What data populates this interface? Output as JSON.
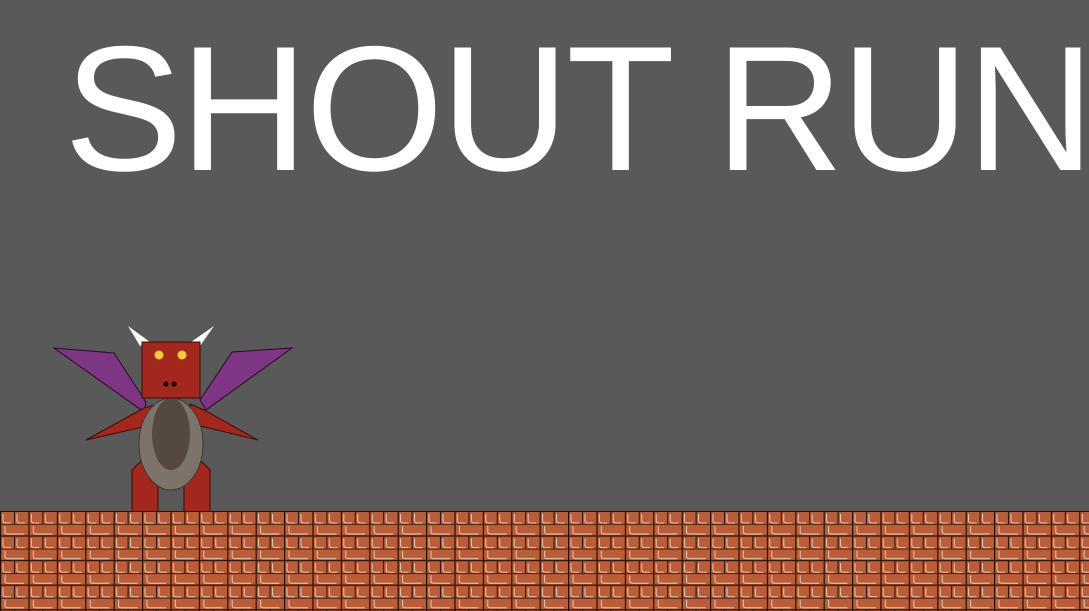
{
  "title": "SHOUT RUN",
  "player": {
    "sprite": "red-winged-dragon",
    "colors": {
      "body": "#a3271d",
      "belly_outer": "#7d7469",
      "belly_inner": "#55493f",
      "wings": "#7e3584",
      "horns": "#ffffff",
      "eyes": "#f4cd33"
    }
  },
  "ground": {
    "tile": "brick",
    "colors": {
      "brick": "#bb5e37",
      "mortar": "#1f0f08",
      "highlight": "#e7d5c8"
    }
  },
  "colors": {
    "background": "#595959",
    "title_text": "#ffffff"
  }
}
